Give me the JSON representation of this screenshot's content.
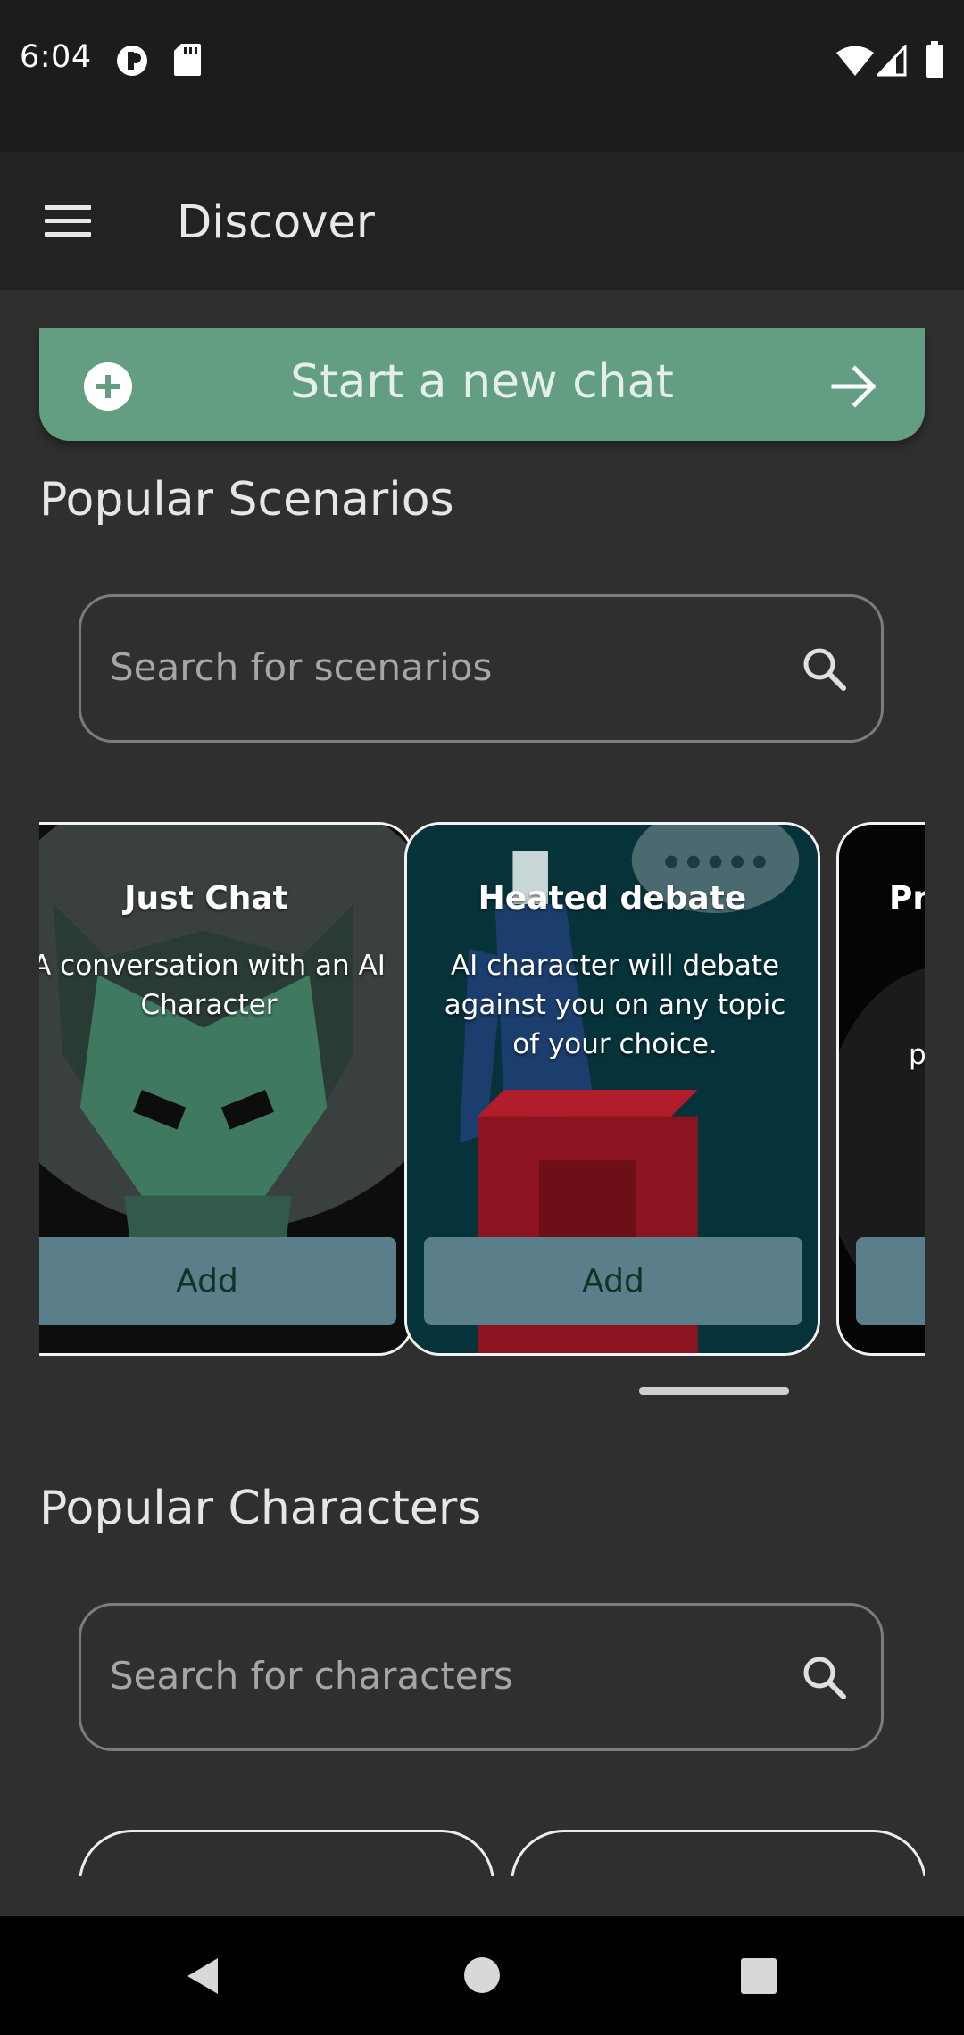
{
  "status_bar": {
    "time": "6:04",
    "left_icons": [
      "notification-app-icon",
      "sd-card-icon"
    ],
    "right_icons": [
      "wifi-icon",
      "cell-signal-icon",
      "battery-icon"
    ]
  },
  "app_bar": {
    "menu_icon": "hamburger-menu-icon",
    "title": "Discover"
  },
  "new_chat": {
    "label": "Start a new chat",
    "left_icon": "plus-circle-icon",
    "right_icon": "arrow-right-icon",
    "color": "#639d82"
  },
  "scenarios": {
    "title": "Popular Scenarios",
    "search_placeholder": "Search for scenarios",
    "cards": [
      {
        "title": "Just Chat",
        "description": "A conversation with an AI Character",
        "button": "Add"
      },
      {
        "title": "Heated debate",
        "description": "AI character will debate against you on any topic of your choice.",
        "button": "Add"
      },
      {
        "title": "Pr",
        "description": "p",
        "button": ""
      }
    ]
  },
  "characters": {
    "title": "Popular Characters",
    "search_placeholder": "Search for characters"
  },
  "nav_bar": {
    "icons": [
      "back-icon",
      "home-icon",
      "recents-icon"
    ]
  }
}
